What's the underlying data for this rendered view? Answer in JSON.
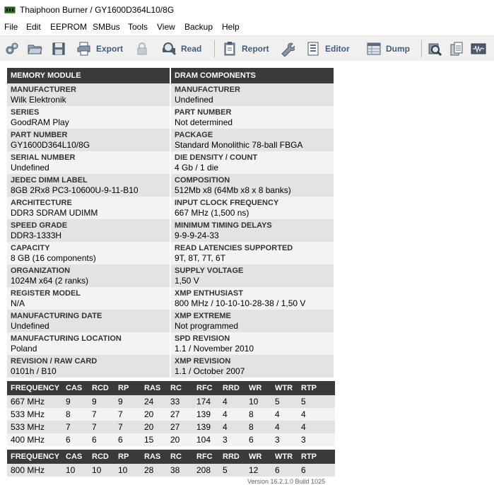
{
  "window": {
    "title": "Thaiphoon Burner / GY1600D364L10/8G"
  },
  "menu": [
    "File",
    "Edit",
    "EEPROM",
    "SMBus",
    "Tools",
    "View",
    "Backup",
    "Help"
  ],
  "toolbar": {
    "export_label": "Export",
    "read_label": "Read",
    "report_label": "Report",
    "editor_label": "Editor",
    "dump_label": "Dump"
  },
  "report": {
    "left_header": "MEMORY MODULE",
    "right_header": "DRAM COMPONENTS",
    "rows": [
      {
        "l_label": "MANUFACTURER",
        "l_value": "Wilk Elektronik",
        "r_label": "MANUFACTURER",
        "r_value": "Undefined"
      },
      {
        "l_label": "SERIES",
        "l_value": "GoodRAM Play",
        "r_label": "PART NUMBER",
        "r_value": "Not determined"
      },
      {
        "l_label": "PART NUMBER",
        "l_value": "GY1600D364L10/8G",
        "r_label": "PACKAGE",
        "r_value": "Standard Monolithic 78-ball FBGA"
      },
      {
        "l_label": "SERIAL NUMBER",
        "l_value": "Undefined",
        "r_label": "DIE DENSITY / COUNT",
        "r_value": "4 Gb / 1 die"
      },
      {
        "l_label": "JEDEC DIMM LABEL",
        "l_value": "8GB 2Rx8 PC3-10600U-9-11-B10",
        "r_label": "COMPOSITION",
        "r_value": "512Mb x8 (64Mb x8 x 8 banks)"
      },
      {
        "l_label": "ARCHITECTURE",
        "l_value": "DDR3 SDRAM UDIMM",
        "r_label": "INPUT CLOCK FREQUENCY",
        "r_value": "667 MHz (1,500 ns)"
      },
      {
        "l_label": "SPEED GRADE",
        "l_value": "DDR3-1333H",
        "r_label": "MINIMUM TIMING DELAYS",
        "r_value": "9-9-9-24-33"
      },
      {
        "l_label": "CAPACITY",
        "l_value": "8 GB (16 components)",
        "r_label": "READ LATENCIES SUPPORTED",
        "r_value": "9T, 8T, 7T, 6T"
      },
      {
        "l_label": "ORGANIZATION",
        "l_value": "1024M x64 (2 ranks)",
        "r_label": "SUPPLY VOLTAGE",
        "r_value": "1,50 V"
      },
      {
        "l_label": "REGISTER MODEL",
        "l_value": "N/A",
        "r_label": "XMP ENTHUSIAST",
        "r_value": "800 MHz / 10-10-10-28-38 / 1,50 V"
      },
      {
        "l_label": "MANUFACTURING DATE",
        "l_value": "Undefined",
        "r_label": "XMP EXTREME",
        "r_value": "Not programmed"
      },
      {
        "l_label": "MANUFACTURING LOCATION",
        "l_value": "Poland",
        "r_label": "SPD REVISION",
        "r_value": "1.1 / November 2010"
      },
      {
        "l_label": "REVISION / RAW CARD",
        "l_value": "0101h / B10",
        "r_label": "XMP REVISION",
        "r_value": "1.1 / October 2007"
      }
    ]
  },
  "timings_jedec": {
    "headers": [
      "FREQUENCY",
      "CAS",
      "RCD",
      "RP",
      "RAS",
      "RC",
      "RFC",
      "RRD",
      "WR",
      "WTR",
      "RTP"
    ],
    "rows": [
      [
        "667 MHz",
        "9",
        "9",
        "9",
        "24",
        "33",
        "174",
        "4",
        "10",
        "5",
        "5"
      ],
      [
        "533 MHz",
        "8",
        "7",
        "7",
        "20",
        "27",
        "139",
        "4",
        "8",
        "4",
        "4"
      ],
      [
        "533 MHz",
        "7",
        "7",
        "7",
        "20",
        "27",
        "139",
        "4",
        "8",
        "4",
        "4"
      ],
      [
        "400 MHz",
        "6",
        "6",
        "6",
        "15",
        "20",
        "104",
        "3",
        "6",
        "3",
        "3"
      ]
    ]
  },
  "timings_xmp": {
    "headers": [
      "FREQUENCY",
      "CAS",
      "RCD",
      "RP",
      "RAS",
      "RC",
      "RFC",
      "RRD",
      "WR",
      "WTR",
      "RTP"
    ],
    "rows": [
      [
        "800 MHz",
        "10",
        "10",
        "10",
        "28",
        "38",
        "208",
        "5",
        "12",
        "6",
        "6"
      ]
    ]
  },
  "footer": {
    "text": "Version 16.2.1.0 Build 1025"
  }
}
